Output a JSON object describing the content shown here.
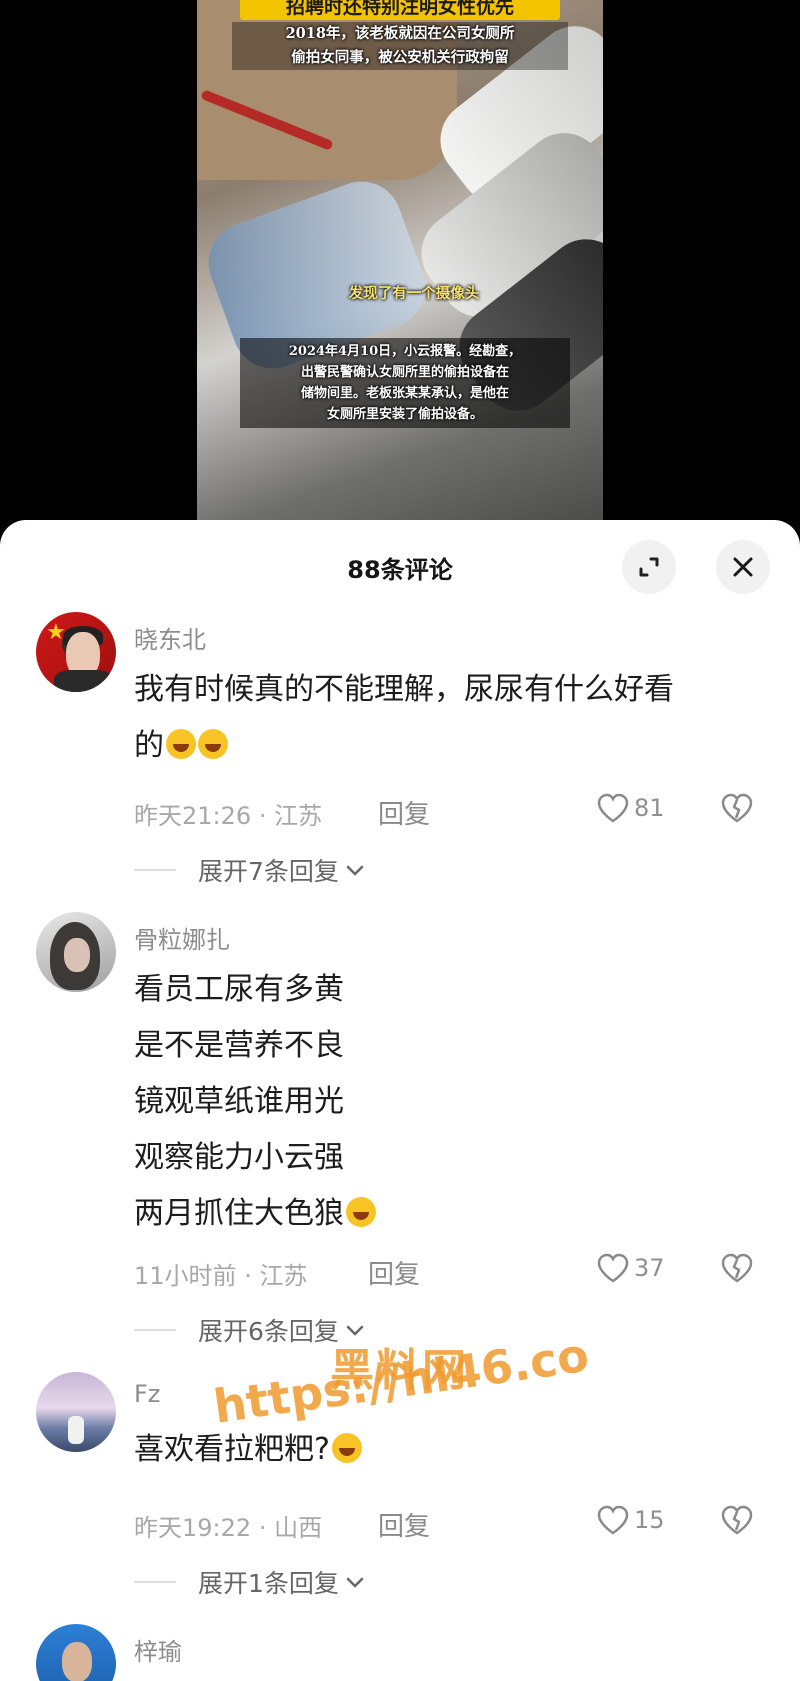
{
  "video": {
    "top_caption": "招聘时还特别注明女性优先",
    "caption_2018_line1": "2018年，该老板就因在公司女厕所",
    "caption_2018_line2": "偷拍女同事，被公安机关行政拘留",
    "caption_mid": "发现了有一个摄像头",
    "caption_2024_line1": "2024年4月10日，小云报警。经勘查，",
    "caption_2024_line2": "出警民警确认女厕所里的偷拍设备在",
    "caption_2024_line3": "储物间里。老板张某某承认，是他在",
    "caption_2024_line4": "女厕所里安装了偷拍设备。"
  },
  "panel": {
    "title": "88条评论",
    "expand_icon": "expand-icon",
    "close_icon": "close-icon"
  },
  "comments": [
    {
      "username": "晓东北",
      "lines": [
        "我有时候真的不能理解，尿尿有什么好看",
        "的"
      ],
      "emoji": "laughing-tears-emoji",
      "time": "昨天21:26",
      "location": "江苏",
      "reply_label": "回复",
      "likes": "81",
      "expand_label": "展开7条回复"
    },
    {
      "username": "骨粒娜扎",
      "lines": [
        "看员工尿有多黄",
        "是不是营养不良",
        "镜观草纸谁用光",
        "观察能力小云强",
        "两月抓住大色狼"
      ],
      "emoji": "facepalm-emoji",
      "time": "11小时前",
      "location": "江苏",
      "reply_label": "回复",
      "likes": "37",
      "expand_label": "展开6条回复"
    },
    {
      "username": "Fz",
      "lines": [
        "喜欢看拉粑粑?"
      ],
      "emoji": "grinning-sweat-emoji",
      "time": "昨天19:22",
      "location": "山西",
      "reply_label": "回复",
      "likes": "15",
      "expand_label": "展开1条回复"
    },
    {
      "username": "梓瑜"
    }
  ],
  "watermark": {
    "line1": "黑料网",
    "line2": "https://hl46.co"
  },
  "colors": {
    "caption_yellow": "#f5c400",
    "watermark_orange": "#f09a2e",
    "meta_gray": "#a8a8a8"
  }
}
